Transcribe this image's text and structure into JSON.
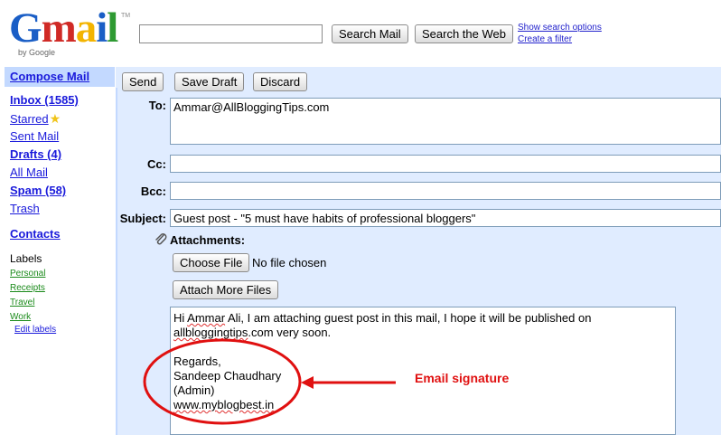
{
  "header": {
    "logo_letters": [
      "G",
      "m",
      "a",
      "i",
      "l"
    ],
    "logo_by": "by Google",
    "logo_tm": "TM",
    "search_value": "",
    "search_mail_label": "Search Mail",
    "search_web_label": "Search the Web",
    "show_options_label": "Show search options",
    "create_filter_label": "Create a filter"
  },
  "sidebar": {
    "compose": "Compose Mail",
    "inbox": "Inbox (1585)",
    "starred": "Starred",
    "star_icon": "★",
    "sent": "Sent Mail",
    "drafts": "Drafts (4)",
    "all": "All Mail",
    "spam": "Spam (58)",
    "trash": "Trash",
    "contacts": "Contacts",
    "labels_heading": "Labels",
    "labels": [
      "Personal",
      "Receipts",
      "Travel",
      "Work"
    ],
    "edit_labels": "Edit labels"
  },
  "compose": {
    "send_label": "Send",
    "save_draft_label": "Save Draft",
    "discard_label": "Discard",
    "to_label": "To:",
    "to_value": "Ammar@AllBloggingTips.com",
    "cc_label": "Cc:",
    "cc_value": "",
    "bcc_label": "Bcc:",
    "bcc_value": "",
    "subject_label": "Subject:",
    "subject_value": "Guest post - \"5 must have habits of professional bloggers\"",
    "attachments_label": "Attachments:",
    "choose_file_label": "Choose File",
    "no_file_text": "No file chosen",
    "attach_more_label": "Attach More Files",
    "body": {
      "line1_pre": "Hi ",
      "line1_name": "Ammar",
      "line1_post": " Ali, I am attaching guest post in this mail, I hope it will be published on",
      "line2_domain": "allbloggingtips",
      "line2_post": ".com very soon.",
      "regards": "Regards,",
      "sig_name": "Sandeep Chaudhary",
      "sig_role": "(Admin)",
      "sig_site": "www.myblogbest.in"
    }
  },
  "annotation": {
    "label": "Email signature",
    "color": "#e01010"
  }
}
